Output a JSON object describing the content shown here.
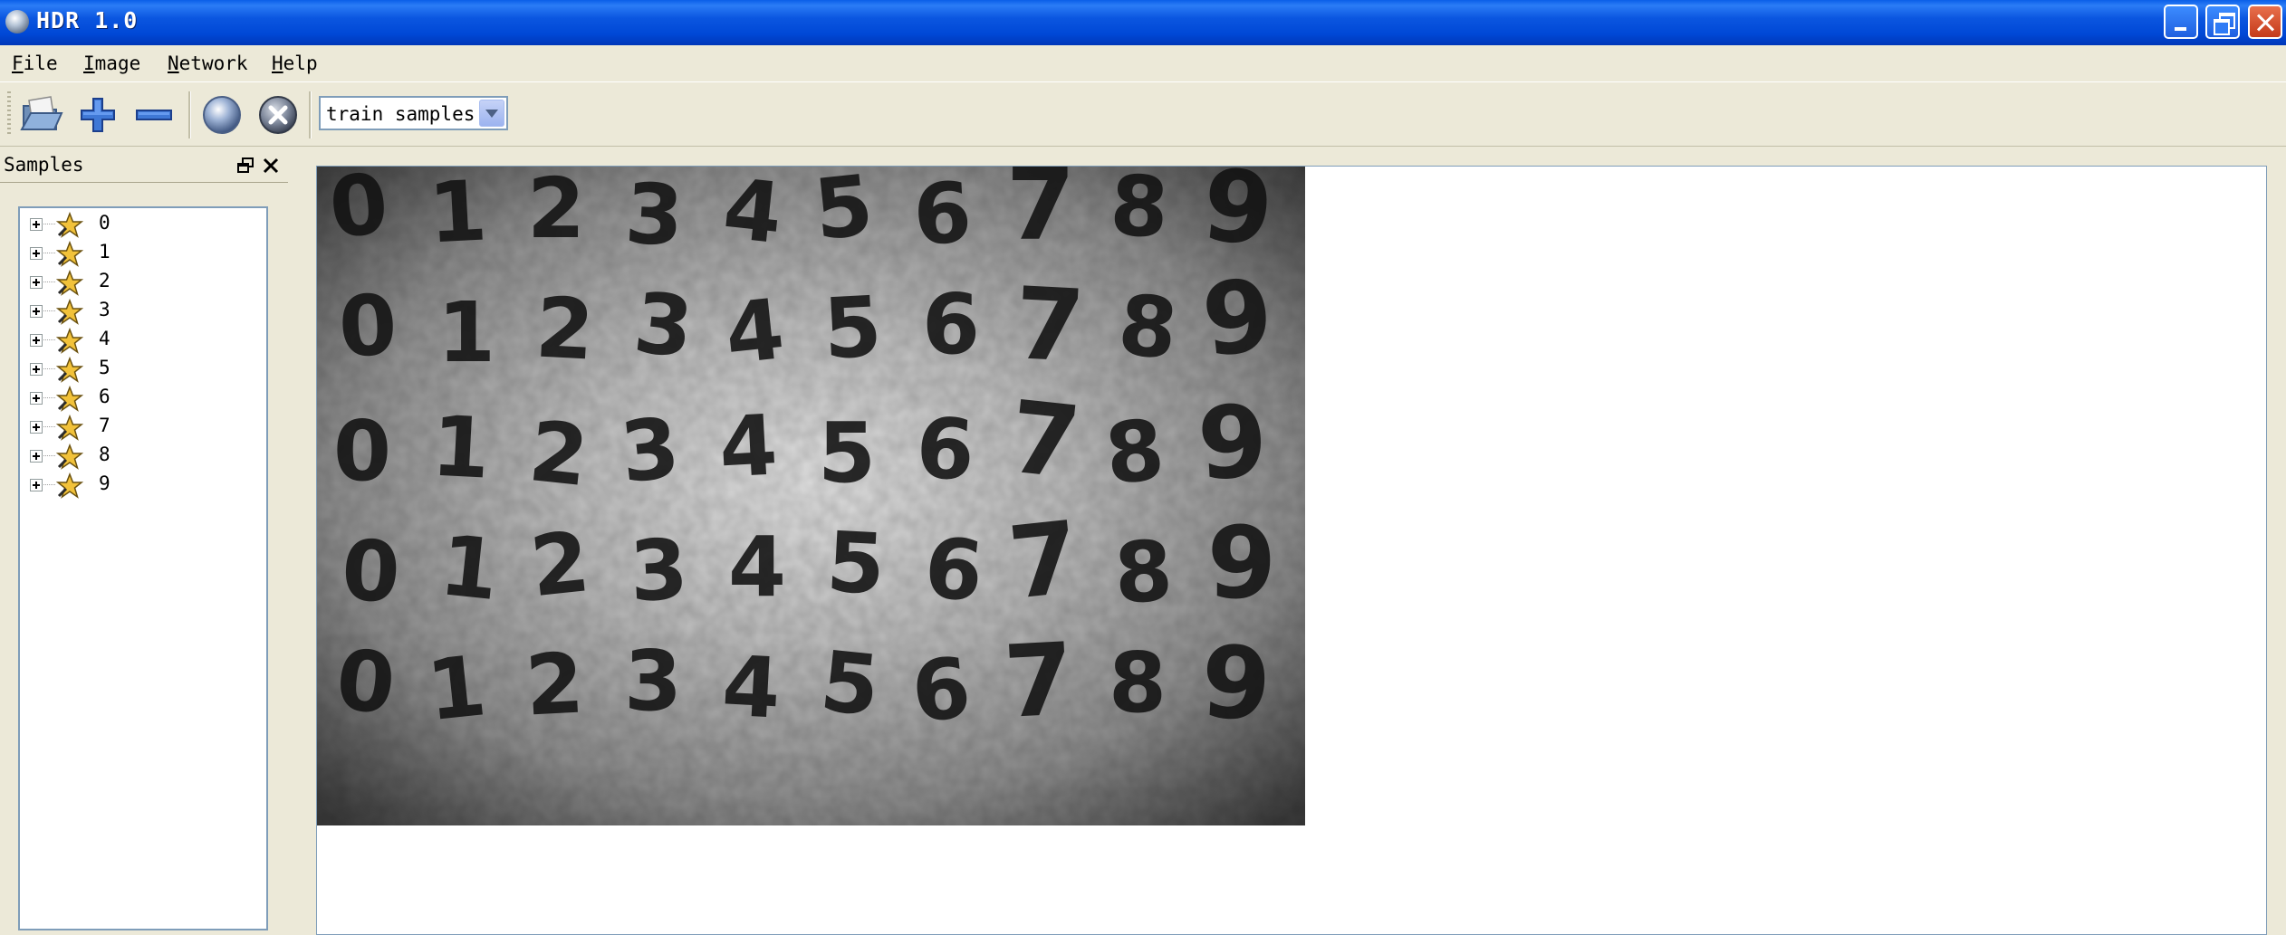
{
  "window": {
    "title": "HDR 1.0"
  },
  "menu": {
    "items": [
      "File",
      "Image",
      "Network",
      "Help"
    ]
  },
  "toolbar": {
    "buttons": [
      "open-folder-icon",
      "add-icon",
      "remove-icon",
      "globe-icon",
      "cancel-icon"
    ],
    "mode_select": {
      "value": "train samples"
    }
  },
  "dock": {
    "title": "Samples",
    "tree": {
      "nodes": [
        "0",
        "1",
        "2",
        "3",
        "4",
        "5",
        "6",
        "7",
        "8",
        "9"
      ]
    }
  },
  "view": {
    "image_content": {
      "description_rows": [
        [
          "0",
          "1",
          "2",
          "3",
          "4",
          "5",
          "6",
          "7",
          "8",
          "9"
        ],
        [
          "0",
          "1",
          "2",
          "3",
          "4",
          "5",
          "6",
          "7",
          "8",
          "9"
        ],
        [
          "0",
          "1",
          "2",
          "3",
          "4",
          "5",
          "6",
          "7",
          "8",
          "9"
        ],
        [
          "0",
          "1",
          "2",
          "3",
          "4",
          "5",
          "6",
          "7",
          "8",
          "9"
        ],
        [
          "0",
          "1",
          "2",
          "3",
          "4",
          "5",
          "6",
          "7",
          "8",
          "9"
        ]
      ]
    }
  },
  "colors": {
    "titlebar": "#0055e5",
    "chrome": "#ece9d8",
    "border": "#7f9db9"
  }
}
